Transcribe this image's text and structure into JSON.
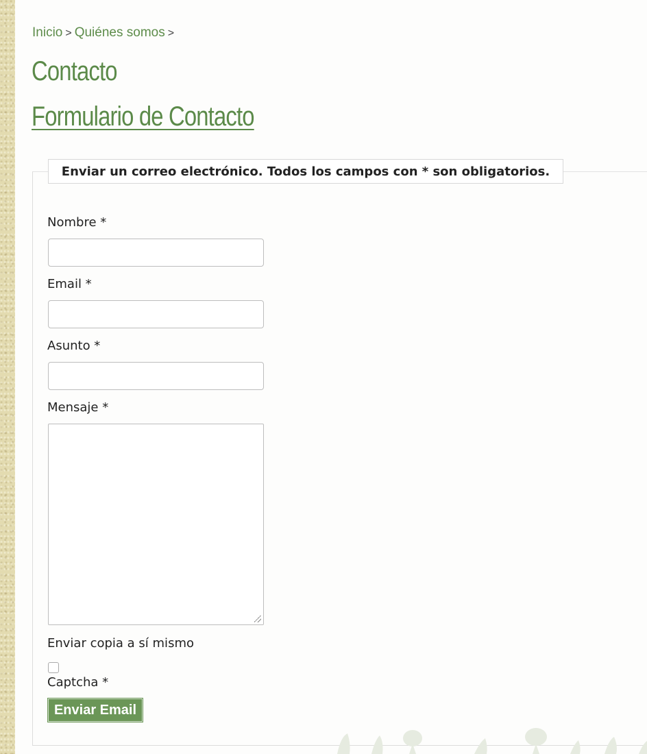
{
  "breadcrumb": {
    "home": "Inicio",
    "separator": ">",
    "about": "Quiénes somos"
  },
  "page": {
    "title": "Contacto",
    "form_title": "Formulario de Contacto"
  },
  "form": {
    "legend": "Enviar un correo electrónico. Todos los campos con * son obligatorios.",
    "name_label": "Nombre *",
    "name_value": "",
    "email_label": "Email *",
    "email_value": "",
    "subject_label": "Asunto *",
    "subject_value": "",
    "message_label": "Mensaje *",
    "message_value": "",
    "copy_label": "Enviar copia a sí mismo",
    "copy_checked": false,
    "captcha_label": "Captcha *",
    "submit_label": "Enviar Email"
  },
  "colors": {
    "accent_green": "#5b8a49",
    "button_green": "#6b9657",
    "side_strip": "#e3dbb0"
  }
}
